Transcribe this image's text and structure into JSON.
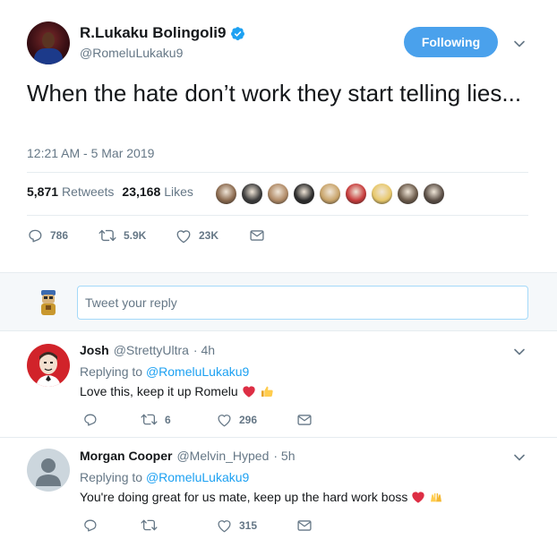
{
  "tweet": {
    "display_name": "R.Lukaku Bolingoli9",
    "handle": "@RomeluLukaku9",
    "follow_label": "Following",
    "text": "When the hate don’t work they start telling lies...",
    "timestamp": "12:21 AM - 5 Mar 2019",
    "retweets_count": "5,871",
    "retweets_label": "Retweets",
    "likes_count": "23,168",
    "likes_label": "Likes",
    "actions": {
      "replies": "786",
      "retweets": "5.9K",
      "likes": "23K"
    },
    "liker_colors": [
      "#8b6a4f",
      "#3c3c3c",
      "#b08a66",
      "#2d2d2d",
      "#c9a46a",
      "#c73b3b",
      "#e8c86b",
      "#6b5a4a",
      "#5b4f46"
    ]
  },
  "reply_box": {
    "placeholder": "Tweet your reply"
  },
  "replies": [
    {
      "name": "Josh",
      "handle": "@StrettyUltra",
      "time": "· 4h",
      "replying_prefix": "Replying to",
      "replying_to": "@RomeluLukaku9",
      "text": "Love this, keep it up Romelu",
      "retweets": "6",
      "likes": "296"
    },
    {
      "name": "Morgan Cooper",
      "handle": "@Melvin_Hyped",
      "time": "· 5h",
      "replying_prefix": "Replying to",
      "replying_to": "@RomeluLukaku9",
      "text": "You're doing great for us mate, keep up the hard work boss",
      "retweets": "",
      "likes": "315"
    }
  ],
  "colors": {
    "accent": "#1da1f2",
    "follow_button": "#4aa1ec",
    "secondary_text": "#657786",
    "heart": "#e0245e"
  },
  "icons": [
    "verified-badge-icon",
    "chevron-down-icon",
    "reply-icon",
    "retweet-icon",
    "like-icon",
    "dm-icon",
    "red-heart-emoji",
    "thumbs-up-emoji",
    "raised-hands-emoji"
  ]
}
